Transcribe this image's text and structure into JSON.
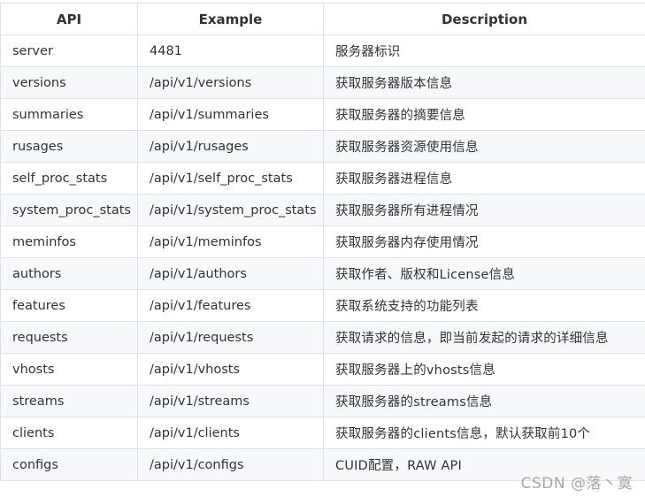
{
  "table": {
    "headers": [
      "API",
      "Example",
      "Description"
    ],
    "rows": [
      {
        "api": "server",
        "example": "4481",
        "description": "服务器标识"
      },
      {
        "api": "versions",
        "example": "/api/v1/versions",
        "description": "获取服务器版本信息"
      },
      {
        "api": "summaries",
        "example": "/api/v1/summaries",
        "description": "获取服务器的摘要信息"
      },
      {
        "api": "rusages",
        "example": "/api/v1/rusages",
        "description": "获取服务器资源使用信息"
      },
      {
        "api": "self_proc_stats",
        "example": "/api/v1/self_proc_stats",
        "description": "获取服务器进程信息"
      },
      {
        "api": "system_proc_stats",
        "example": "/api/v1/system_proc_stats",
        "description": "获取服务器所有进程情况"
      },
      {
        "api": "meminfos",
        "example": "/api/v1/meminfos",
        "description": "获取服务器内存使用情况"
      },
      {
        "api": "authors",
        "example": "/api/v1/authors",
        "description": "获取作者、版权和License信息"
      },
      {
        "api": "features",
        "example": "/api/v1/features",
        "description": "获取系统支持的功能列表"
      },
      {
        "api": "requests",
        "example": "/api/v1/requests",
        "description": "获取请求的信息，即当前发起的请求的详细信息"
      },
      {
        "api": "vhosts",
        "example": "/api/v1/vhosts",
        "description": "获取服务器上的vhosts信息"
      },
      {
        "api": "streams",
        "example": "/api/v1/streams",
        "description": "获取服务器的streams信息"
      },
      {
        "api": "clients",
        "example": "/api/v1/clients",
        "description": "获取服务器的clients信息，默认获取前10个"
      },
      {
        "api": "configs",
        "example": "/api/v1/configs",
        "description": "CUID配置，RAW API"
      }
    ]
  },
  "watermark": "CSDN @落丶寞",
  "colors": {
    "border": "#dfe2e5",
    "stripe": "#f6f8fa",
    "text": "#333333",
    "watermark": "#a6a6a6"
  }
}
